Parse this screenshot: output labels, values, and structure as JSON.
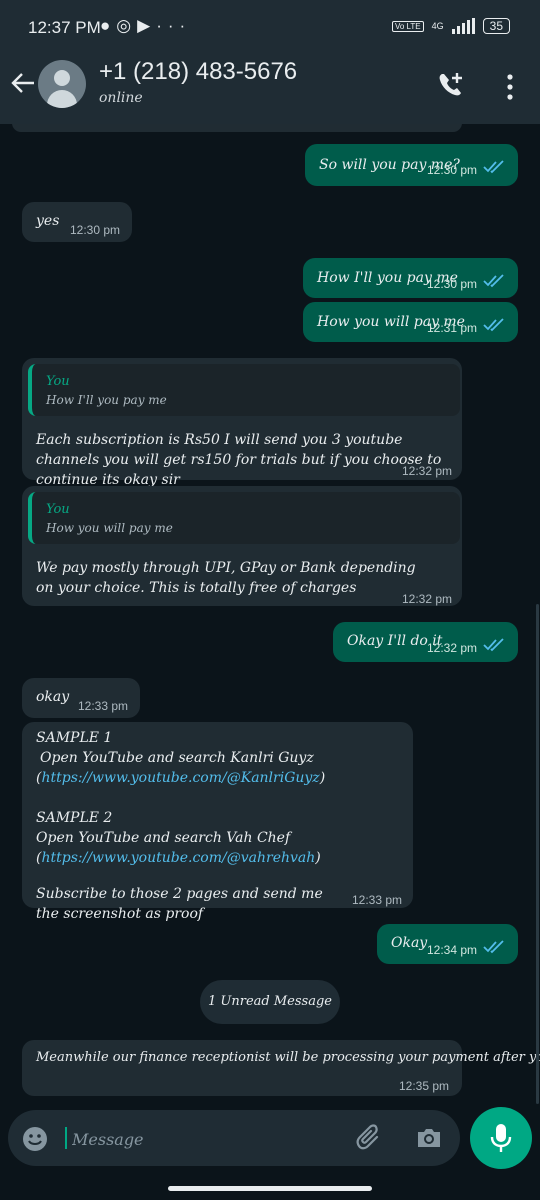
{
  "status_bar": {
    "time": "12:37 PM",
    "network": "4G",
    "volte": "Vo LTE",
    "battery": "35"
  },
  "header": {
    "contact_name": "+1 (218) 483-5676",
    "contact_status": "online"
  },
  "messages": [
    {
      "direction": "out",
      "text": "So will you pay me?",
      "time": "12:30 pm"
    },
    {
      "direction": "in",
      "text": "yes",
      "time": "12:30 pm"
    },
    {
      "direction": "out",
      "text": "How I'll you pay me",
      "time": "12:30 pm"
    },
    {
      "direction": "out",
      "text": "How you will pay me",
      "time": "12:31 pm"
    },
    {
      "direction": "in",
      "quote_author": "You",
      "quote_text": "How I'll you pay me",
      "text": "Each subscription is Rs50 I will send you 3 youtube channels you will get rs150 for trials but if you choose to continue its okay sir",
      "time": "12:32 pm"
    },
    {
      "direction": "in",
      "quote_author": "You",
      "quote_text": "How you will pay me",
      "text": "We pay mostly through UPI, GPay or Bank depending on your choice. This is totally free of charges",
      "time": "12:32 pm"
    },
    {
      "direction": "out",
      "text": "Okay I'll do it",
      "time": "12:32 pm"
    },
    {
      "direction": "in",
      "text": "okay",
      "time": "12:33 pm"
    },
    {
      "direction": "in",
      "sample1_title": "SAMPLE 1",
      "sample1_line": "Open YouTube and search Kanlri Guyz",
      "sample1_link": "https://www.youtube.com/@KanlriGuyz",
      "sample2_title": "SAMPLE 2",
      "sample2_line": "Open YouTube and search Vah Chef",
      "sample2_link": "https://www.youtube.com/@vahrehvah",
      "closing": "Subscribe to those 2 pages and send me the screenshot as proof",
      "time": "12:33 pm"
    },
    {
      "direction": "out",
      "text": "Okay",
      "time": "12:34 pm"
    },
    {
      "direction": "in",
      "text": "Meanwhile our finance receptionist will be processing your payment after you are done",
      "time": "12:35 pm"
    }
  ],
  "unread_label": "1 Unread Message",
  "composer": {
    "placeholder": "Message"
  },
  "colors": {
    "header_bg": "#1f2c34",
    "chat_bg": "#0b141a",
    "incoming": "#202c33",
    "outgoing": "#005c4b",
    "accent": "#00a884",
    "read_ticks": "#53bdeb"
  }
}
